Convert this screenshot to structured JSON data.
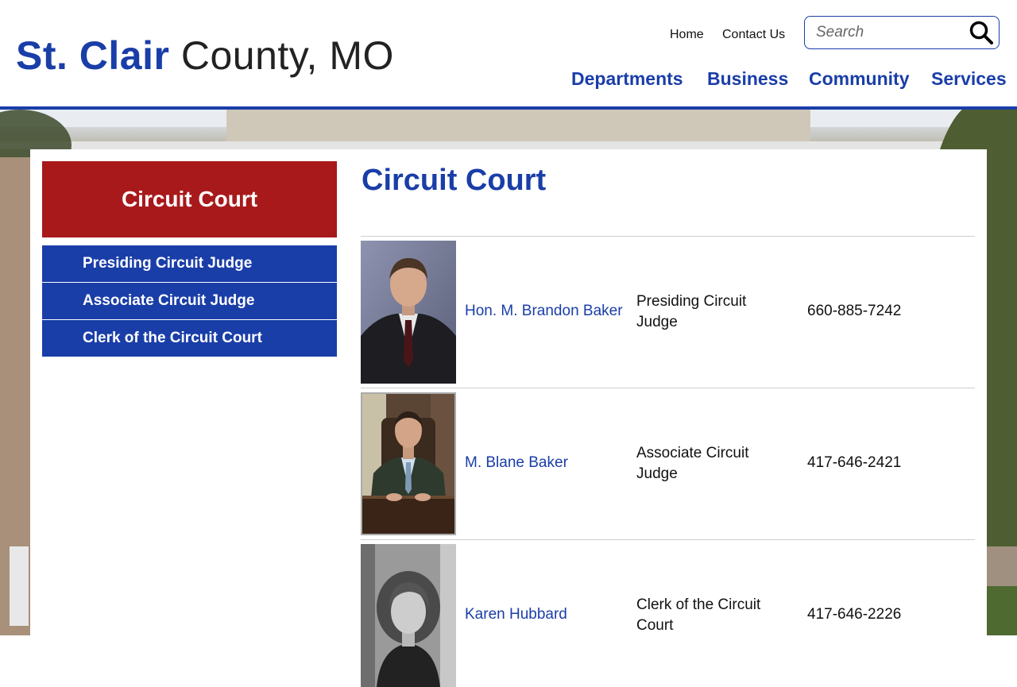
{
  "header": {
    "logo_bold": "St. Clair",
    "logo_rest": " County, MO",
    "util_links": [
      "Home",
      "Contact Us"
    ],
    "search_placeholder": "Search",
    "nav": [
      "Departments",
      "Business",
      "Community",
      "Services"
    ]
  },
  "sidebar": {
    "heading": "Circuit Court",
    "items": [
      "Presiding Circuit Judge",
      "Associate Circuit Judge",
      "Clerk of the Circuit Court"
    ]
  },
  "main": {
    "title": "Circuit Court",
    "people": [
      {
        "name": "Hon. M. Brandon Baker",
        "title": "Presiding Circuit Judge",
        "phone": "660-885-7242"
      },
      {
        "name": "M. Blane Baker",
        "title": "Associate Circuit Judge",
        "phone": "417-646-2421"
      },
      {
        "name": "Karen Hubbard",
        "title": "Clerk of the Circuit Court",
        "phone": "417-646-2226"
      }
    ]
  },
  "colors": {
    "brand_blue": "#1a3ea8",
    "brand_red": "#a8191b"
  }
}
